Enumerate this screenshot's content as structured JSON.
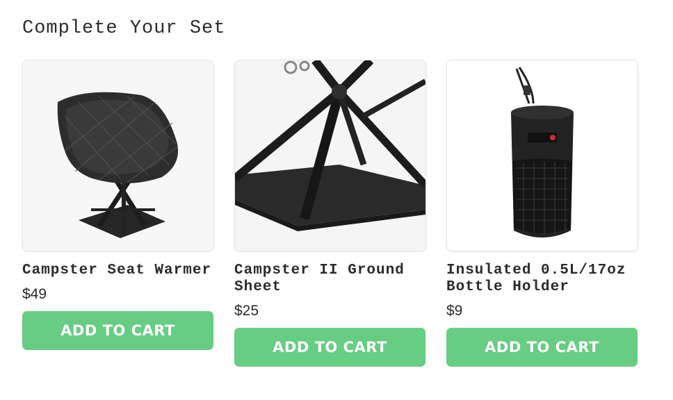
{
  "section": {
    "title": "Complete Your Set"
  },
  "products": [
    {
      "name": "Campster Seat Warmer",
      "price": "$49",
      "cta_label": "ADD TO CART",
      "image_icon": "quilted-chair-warmer-image"
    },
    {
      "name": "Campster II Ground Sheet",
      "price": "$25",
      "cta_label": "ADD TO CART",
      "image_icon": "chair-ground-sheet-image"
    },
    {
      "name": "Insulated 0.5L/17oz Bottle Holder",
      "price": "$9",
      "cta_label": "ADD TO CART",
      "image_icon": "bottle-holder-image"
    }
  ],
  "colors": {
    "cta_background": "#66cd82",
    "cta_text": "#ffffff",
    "text": "#2b2b2b"
  }
}
